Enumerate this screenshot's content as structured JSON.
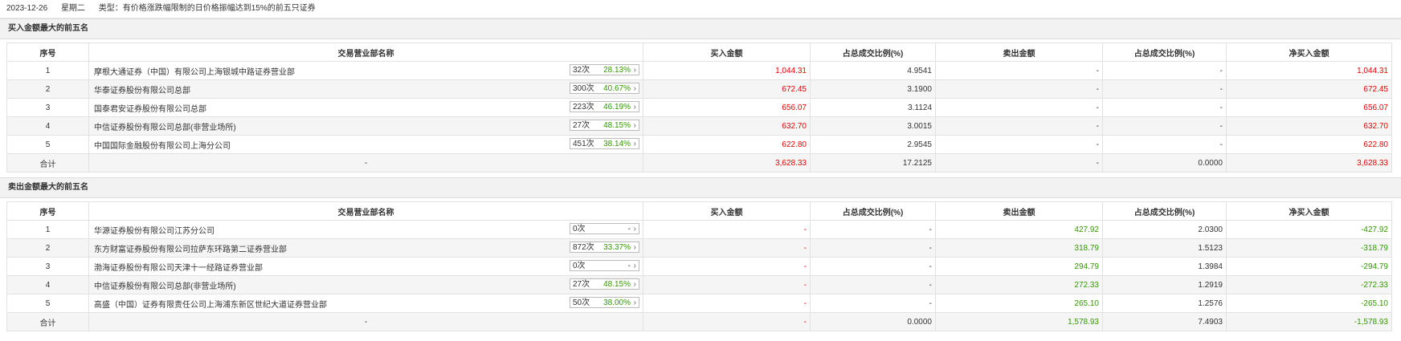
{
  "header": {
    "date": "2023-12-26",
    "weekday": "星期二",
    "type_text": "类型：有价格涨跌幅限制的日价格振幅达到15%的前五只证券"
  },
  "columns": {
    "idx": "序号",
    "dept": "交易营业部名称",
    "buy": "买入金额",
    "buy_pct": "占总成交比例(%)",
    "sell": "卖出金额",
    "sell_pct": "占总成交比例(%)",
    "net": "净买入金额"
  },
  "buy_section": {
    "title": "买入金额最大的前五名",
    "rows": [
      {
        "idx": "1",
        "dept": "摩根大通证券（中国）有限公司上海银城中路证券营业部",
        "count": "32次",
        "rate": "28.13%",
        "buy": "1,044.31",
        "buy_pct": "4.9541",
        "sell": "-",
        "sell_pct": "-",
        "net": "1,044.31"
      },
      {
        "idx": "2",
        "dept": "华泰证券股份有限公司总部",
        "count": "300次",
        "rate": "40.67%",
        "buy": "672.45",
        "buy_pct": "3.1900",
        "sell": "-",
        "sell_pct": "-",
        "net": "672.45"
      },
      {
        "idx": "3",
        "dept": "国泰君安证券股份有限公司总部",
        "count": "223次",
        "rate": "46.19%",
        "buy": "656.07",
        "buy_pct": "3.1124",
        "sell": "-",
        "sell_pct": "-",
        "net": "656.07"
      },
      {
        "idx": "4",
        "dept": "中信证券股份有限公司总部(非营业场所)",
        "count": "27次",
        "rate": "48.15%",
        "buy": "632.70",
        "buy_pct": "3.0015",
        "sell": "-",
        "sell_pct": "-",
        "net": "632.70"
      },
      {
        "idx": "5",
        "dept": "中国国际金融股份有限公司上海分公司",
        "count": "451次",
        "rate": "38.14%",
        "buy": "622.80",
        "buy_pct": "2.9545",
        "sell": "-",
        "sell_pct": "-",
        "net": "622.80"
      }
    ],
    "total": {
      "idx": "合计",
      "dept": "-",
      "buy": "3,628.33",
      "buy_pct": "17.2125",
      "sell": "-",
      "sell_pct": "0.0000",
      "net": "3,628.33"
    }
  },
  "sell_section": {
    "title": "卖出金额最大的前五名",
    "rows": [
      {
        "idx": "1",
        "dept": "华源证券股份有限公司江苏分公司",
        "count": "0次",
        "rate": "-",
        "buy": "-",
        "buy_pct": "-",
        "sell": "427.92",
        "sell_pct": "2.0300",
        "net": "-427.92"
      },
      {
        "idx": "2",
        "dept": "东方财富证券股份有限公司拉萨东环路第二证券营业部",
        "count": "872次",
        "rate": "33.37%",
        "buy": "-",
        "buy_pct": "-",
        "sell": "318.79",
        "sell_pct": "1.5123",
        "net": "-318.79"
      },
      {
        "idx": "3",
        "dept": "渤海证券股份有限公司天津十一经路证券营业部",
        "count": "0次",
        "rate": "-",
        "buy": "-",
        "buy_pct": "-",
        "sell": "294.79",
        "sell_pct": "1.3984",
        "net": "-294.79"
      },
      {
        "idx": "4",
        "dept": "中信证券股份有限公司总部(非营业场所)",
        "count": "27次",
        "rate": "48.15%",
        "buy": "-",
        "buy_pct": "-",
        "sell": "272.33",
        "sell_pct": "1.2919",
        "net": "-272.33"
      },
      {
        "idx": "5",
        "dept": "高盛（中国）证券有限责任公司上海浦东新区世纪大道证券营业部",
        "count": "50次",
        "rate": "38.00%",
        "buy": "-",
        "buy_pct": "-",
        "sell": "265.10",
        "sell_pct": "1.2576",
        "net": "-265.10"
      }
    ],
    "total": {
      "idx": "合计",
      "dept": "-",
      "buy": "-",
      "buy_pct": "0.0000",
      "sell": "1,578.93",
      "sell_pct": "7.4903",
      "net": "-1,578.93"
    }
  },
  "colors": {
    "buy": "#ee0000",
    "sell": "#339900"
  }
}
